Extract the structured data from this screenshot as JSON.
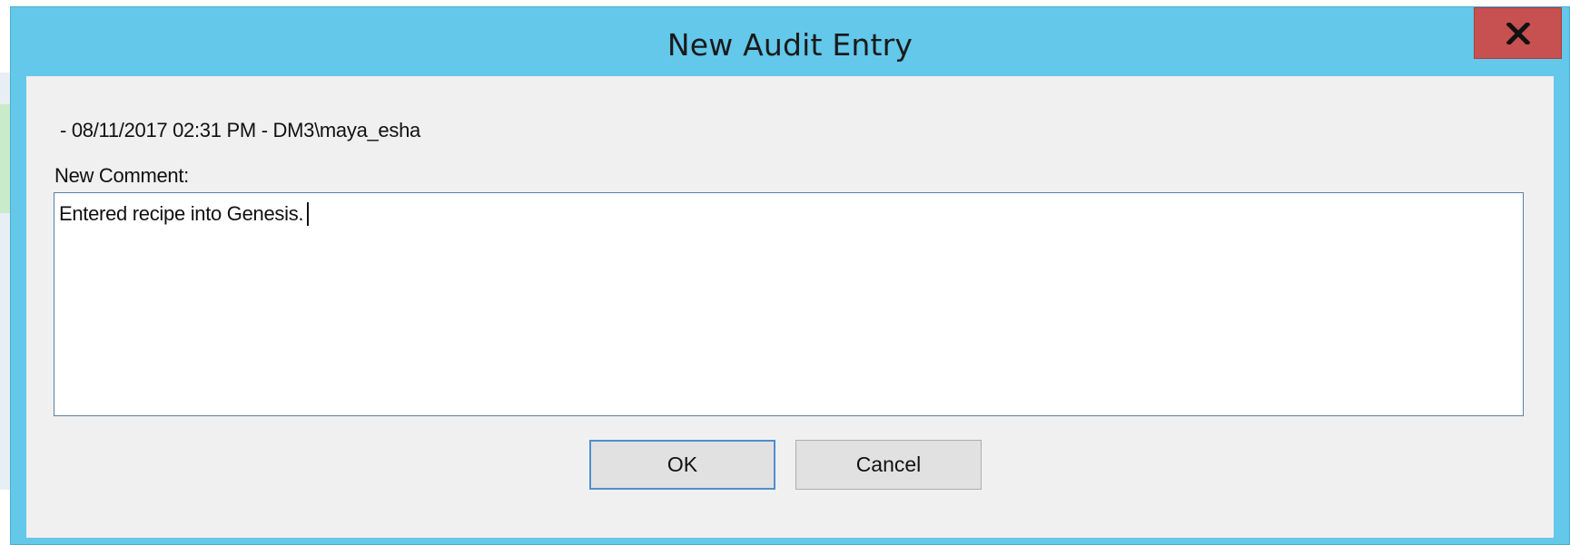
{
  "dialog": {
    "title": "New Audit Entry",
    "close_icon": "close-x-icon",
    "close_color": "#c75050",
    "titlebar_color": "#63c8ea"
  },
  "entry": {
    "header": "- 08/11/2017 02:31 PM - DM3\\maya_esha"
  },
  "comment": {
    "label": "New Comment:",
    "value": "Entered recipe into Genesis."
  },
  "buttons": {
    "ok_label": "OK",
    "cancel_label": "Cancel"
  }
}
